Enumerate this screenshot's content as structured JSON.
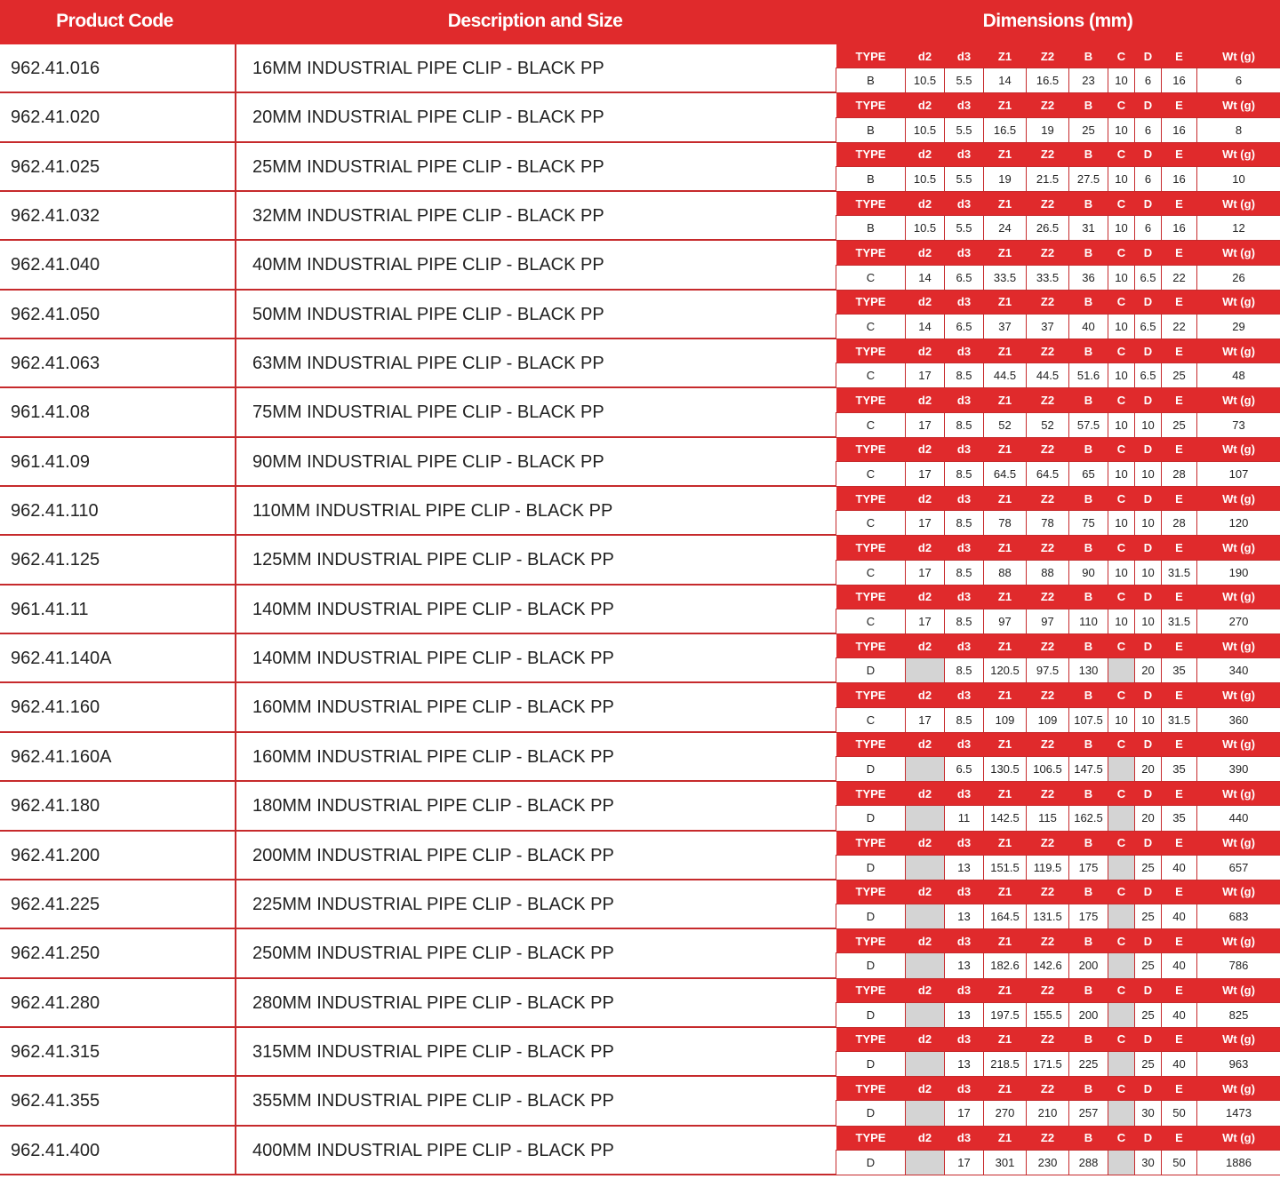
{
  "header": {
    "product_code": "Product Code",
    "description": "Description and Size",
    "dimensions": "Dimensions (mm)"
  },
  "dim_headers": [
    "TYPE",
    "d2",
    "d3",
    "Z1",
    "Z2",
    "B",
    "C",
    "D",
    "E",
    "Wt (g)"
  ],
  "rows": [
    {
      "code": "962.41.016",
      "desc": "16MM INDUSTRIAL PIPE CLIP - BLACK PP",
      "dims": [
        "B",
        "10.5",
        "5.5",
        "14",
        "16.5",
        "23",
        "10",
        "6",
        "16",
        "6"
      ]
    },
    {
      "code": "962.41.020",
      "desc": "20MM INDUSTRIAL PIPE CLIP - BLACK PP",
      "dims": [
        "B",
        "10.5",
        "5.5",
        "16.5",
        "19",
        "25",
        "10",
        "6",
        "16",
        "8"
      ]
    },
    {
      "code": "962.41.025",
      "desc": "25MM INDUSTRIAL PIPE CLIP - BLACK PP",
      "dims": [
        "B",
        "10.5",
        "5.5",
        "19",
        "21.5",
        "27.5",
        "10",
        "6",
        "16",
        "10"
      ]
    },
    {
      "code": "962.41.032",
      "desc": "32MM INDUSTRIAL PIPE CLIP - BLACK PP",
      "dims": [
        "B",
        "10.5",
        "5.5",
        "24",
        "26.5",
        "31",
        "10",
        "6",
        "16",
        "12"
      ]
    },
    {
      "code": "962.41.040",
      "desc": "40MM INDUSTRIAL PIPE CLIP - BLACK PP",
      "dims": [
        "C",
        "14",
        "6.5",
        "33.5",
        "33.5",
        "36",
        "10",
        "6.5",
        "22",
        "26"
      ]
    },
    {
      "code": "962.41.050",
      "desc": "50MM INDUSTRIAL PIPE CLIP - BLACK PP",
      "dims": [
        "C",
        "14",
        "6.5",
        "37",
        "37",
        "40",
        "10",
        "6.5",
        "22",
        "29"
      ]
    },
    {
      "code": "962.41.063",
      "desc": "63MM INDUSTRIAL PIPE CLIP - BLACK PP",
      "dims": [
        "C",
        "17",
        "8.5",
        "44.5",
        "44.5",
        "51.6",
        "10",
        "6.5",
        "25",
        "48"
      ]
    },
    {
      "code": "961.41.08",
      "desc": "75MM INDUSTRIAL PIPE CLIP - BLACK PP",
      "dims": [
        "C",
        "17",
        "8.5",
        "52",
        "52",
        "57.5",
        "10",
        "10",
        "25",
        "73"
      ]
    },
    {
      "code": "961.41.09",
      "desc": "90MM INDUSTRIAL PIPE CLIP - BLACK PP",
      "dims": [
        "C",
        "17",
        "8.5",
        "64.5",
        "64.5",
        "65",
        "10",
        "10",
        "28",
        "107"
      ]
    },
    {
      "code": "962.41.110",
      "desc": "110MM INDUSTRIAL PIPE CLIP - BLACK PP",
      "dims": [
        "C",
        "17",
        "8.5",
        "78",
        "78",
        "75",
        "10",
        "10",
        "28",
        "120"
      ]
    },
    {
      "code": "962.41.125",
      "desc": "125MM INDUSTRIAL PIPE CLIP - BLACK PP",
      "dims": [
        "C",
        "17",
        "8.5",
        "88",
        "88",
        "90",
        "10",
        "10",
        "31.5",
        "190"
      ]
    },
    {
      "code": "961.41.11",
      "desc": "140MM INDUSTRIAL PIPE CLIP - BLACK PP",
      "dims": [
        "C",
        "17",
        "8.5",
        "97",
        "97",
        "110",
        "10",
        "10",
        "31.5",
        "270"
      ]
    },
    {
      "code": "962.41.140A",
      "desc": "140MM INDUSTRIAL PIPE CLIP - BLACK PP",
      "dims": [
        "D",
        "",
        "8.5",
        "120.5",
        "97.5",
        "130",
        "",
        "20",
        "35",
        "340"
      ]
    },
    {
      "code": "962.41.160",
      "desc": "160MM INDUSTRIAL PIPE CLIP - BLACK PP",
      "dims": [
        "C",
        "17",
        "8.5",
        "109",
        "109",
        "107.5",
        "10",
        "10",
        "31.5",
        "360"
      ]
    },
    {
      "code": "962.41.160A",
      "desc": "160MM INDUSTRIAL PIPE CLIP - BLACK PP",
      "dims": [
        "D",
        "",
        "6.5",
        "130.5",
        "106.5",
        "147.5",
        "",
        "20",
        "35",
        "390"
      ]
    },
    {
      "code": "962.41.180",
      "desc": "180MM INDUSTRIAL PIPE CLIP - BLACK PP",
      "dims": [
        "D",
        "",
        "11",
        "142.5",
        "115",
        "162.5",
        "",
        "20",
        "35",
        "440"
      ]
    },
    {
      "code": "962.41.200",
      "desc": "200MM INDUSTRIAL PIPE CLIP - BLACK PP",
      "dims": [
        "D",
        "",
        "13",
        "151.5",
        "119.5",
        "175",
        "",
        "25",
        "40",
        "657"
      ]
    },
    {
      "code": "962.41.225",
      "desc": "225MM INDUSTRIAL PIPE CLIP - BLACK PP",
      "dims": [
        "D",
        "",
        "13",
        "164.5",
        "131.5",
        "175",
        "",
        "25",
        "40",
        "683"
      ]
    },
    {
      "code": "962.41.250",
      "desc": "250MM INDUSTRIAL PIPE CLIP - BLACK PP",
      "dims": [
        "D",
        "",
        "13",
        "182.6",
        "142.6",
        "200",
        "",
        "25",
        "40",
        "786"
      ]
    },
    {
      "code": "962.41.280",
      "desc": "280MM INDUSTRIAL PIPE CLIP - BLACK PP",
      "dims": [
        "D",
        "",
        "13",
        "197.5",
        "155.5",
        "200",
        "",
        "25",
        "40",
        "825"
      ]
    },
    {
      "code": "962.41.315",
      "desc": "315MM INDUSTRIAL PIPE CLIP - BLACK PP",
      "dims": [
        "D",
        "",
        "13",
        "218.5",
        "171.5",
        "225",
        "",
        "25",
        "40",
        "963"
      ]
    },
    {
      "code": "962.41.355",
      "desc": "355MM INDUSTRIAL PIPE CLIP - BLACK PP",
      "dims": [
        "D",
        "",
        "17",
        "270",
        "210",
        "257",
        "",
        "30",
        "50",
        "1473"
      ]
    },
    {
      "code": "962.41.400",
      "desc": "400MM INDUSTRIAL PIPE CLIP - BLACK PP",
      "dims": [
        "D",
        "",
        "17",
        "301",
        "230",
        "288",
        "",
        "30",
        "50",
        "1886"
      ]
    }
  ],
  "colors": {
    "accent": "#e02a2c",
    "border": "#c62a2c",
    "blank_cell": "#d4d4d4"
  }
}
